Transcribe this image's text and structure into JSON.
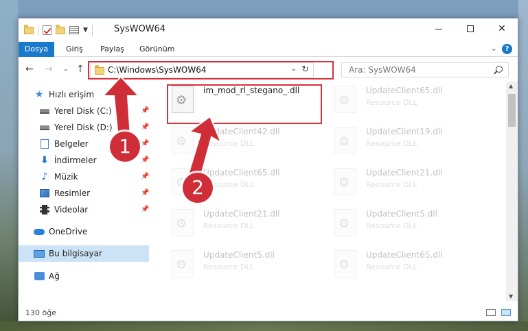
{
  "window": {
    "title": "SysWOW64"
  },
  "ribbon": {
    "tabs": [
      "Dosya",
      "Giriş",
      "Paylaş",
      "Görünüm"
    ]
  },
  "nav": {
    "address": "C:\\Windows\\SysWOW64",
    "search_placeholder": "Ara: SysWOW64"
  },
  "sidebar": {
    "items": [
      {
        "label": "Hızlı erişim",
        "icon": "star-icon",
        "pinned": false
      },
      {
        "label": "Yerel Disk (C:)",
        "icon": "disk-icon",
        "pinned": true
      },
      {
        "label": "Yerel Disk (D:)",
        "icon": "disk-icon",
        "pinned": true
      },
      {
        "label": "Belgeler",
        "icon": "documents-icon",
        "pinned": true
      },
      {
        "label": "İndirmeler",
        "icon": "download-icon",
        "pinned": true
      },
      {
        "label": "Müzik",
        "icon": "music-icon",
        "pinned": true
      },
      {
        "label": "Resimler",
        "icon": "pictures-icon",
        "pinned": true
      },
      {
        "label": "Videolar",
        "icon": "video-icon",
        "pinned": true
      },
      {
        "label": "OneDrive",
        "icon": "cloud-icon",
        "pinned": false
      },
      {
        "label": "Bu bilgisayar",
        "icon": "computer-icon",
        "pinned": false,
        "selected": true
      },
      {
        "label": "Ağ",
        "icon": "network-icon",
        "pinned": false
      }
    ]
  },
  "files": {
    "main": {
      "name": "im_mod_rl_stegano_.dll"
    },
    "tiles": [
      {
        "name": "UpdateClient65.dll",
        "type": "Resource DLL"
      },
      {
        "name": "UpdateClient42.dll",
        "type": "Resource DLL"
      },
      {
        "name": "UpdateClient19.dll",
        "type": "Resource DLL"
      },
      {
        "name": "UpdateClient65.dll",
        "type": "Resource DLL"
      },
      {
        "name": "UpdateClient21.dll",
        "type": "Resource DLL"
      },
      {
        "name": "UpdateClient21.dll",
        "type": "Resource DLL"
      },
      {
        "name": "UpdateClient5.dll",
        "type": "Resource DLL"
      },
      {
        "name": "UpdateClient5.dll",
        "type": "Resource DLL"
      },
      {
        "name": "UpdateClient65.dll",
        "type": "Resource DLL"
      }
    ]
  },
  "status": {
    "count": "130 öğe"
  },
  "annotations": {
    "marker1": "1",
    "marker2": "2",
    "color": "#cf2d37"
  }
}
